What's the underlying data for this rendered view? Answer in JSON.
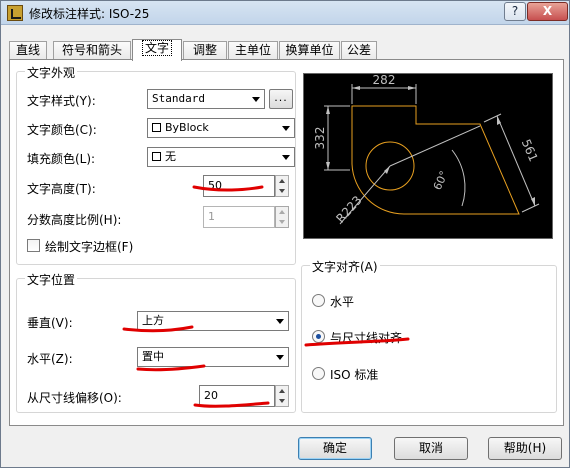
{
  "window": {
    "title": "修改标注样式: ISO-25",
    "help_button": "?",
    "close_button": "X"
  },
  "tabs": [
    "直线",
    "符号和箭头",
    "文字",
    "调整",
    "主单位",
    "换算单位",
    "公差"
  ],
  "text_appearance": {
    "legend": "文字外观",
    "style_label": "文字样式(Y):",
    "style_value": "Standard",
    "browse_button": "...",
    "color_label": "文字颜色(C):",
    "color_value": "ByBlock",
    "fill_label": "填充颜色(L):",
    "fill_value": "无",
    "height_label": "文字高度(T):",
    "height_value": "50",
    "fraction_label": "分数高度比例(H):",
    "fraction_value": "1",
    "frame_label": "绘制文字边框(F)"
  },
  "text_placement": {
    "legend": "文字位置",
    "vertical_label": "垂直(V):",
    "vertical_value": "上方",
    "horizontal_label": "水平(Z):",
    "horizontal_value": "置中",
    "offset_label": "从尺寸线偏移(O):",
    "offset_value": "20"
  },
  "text_alignment": {
    "legend": "文字对齐(A)",
    "options": [
      "水平",
      "与尺寸线对齐",
      "ISO 标准"
    ],
    "selected": "与尺寸线对齐"
  },
  "preview": {
    "dim_top": "282",
    "dim_left": "332",
    "dim_right": "561",
    "dim_angle": "60°",
    "dim_radius": "R223"
  },
  "buttons": {
    "ok": "确定",
    "cancel": "取消",
    "help": "帮助(H)"
  },
  "colors": {
    "preview_lines": "#c0c0c0",
    "preview_geometry": "#e8a020",
    "annotation": "#e00000",
    "radio_dot": "#1c4f9f"
  }
}
